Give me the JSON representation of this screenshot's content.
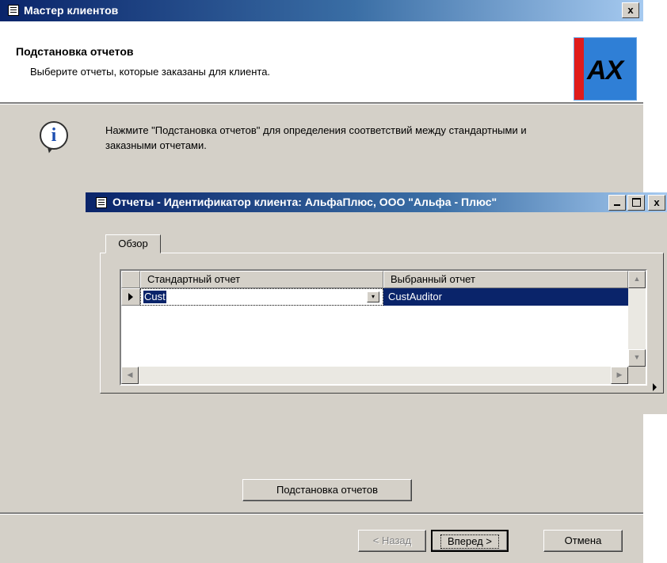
{
  "window": {
    "title": "Мастер клиентов",
    "close_label": "x"
  },
  "header": {
    "title": "Подстановка отчетов",
    "subtitle": "Выберите отчеты, которые заказаны для клиента.",
    "logo_text": "AX"
  },
  "info": {
    "icon_glyph": "i",
    "text": "Нажмите \"Подстановка отчетов\" для определения соответствий между стандартными и заказными отчетами."
  },
  "dialog": {
    "title": "Отчеты - Идентификатор клиента: АльфаПлюс, ООО \"Альфа - Плюс\"",
    "tab_label": "Обзор",
    "columns": [
      "Стандартный отчет",
      "Выбранный отчет"
    ],
    "rows": [
      {
        "standard": "Cust",
        "selected": "CustAuditor"
      }
    ]
  },
  "buttons": {
    "substitute": "Подстановка отчетов",
    "back": "< Назад",
    "next": "Вперед >",
    "cancel": "Отмена"
  },
  "colors": {
    "titlebar_dark": "#0a246a",
    "selection": "#0a246a",
    "dialog_bg": "#d4d0c8"
  }
}
